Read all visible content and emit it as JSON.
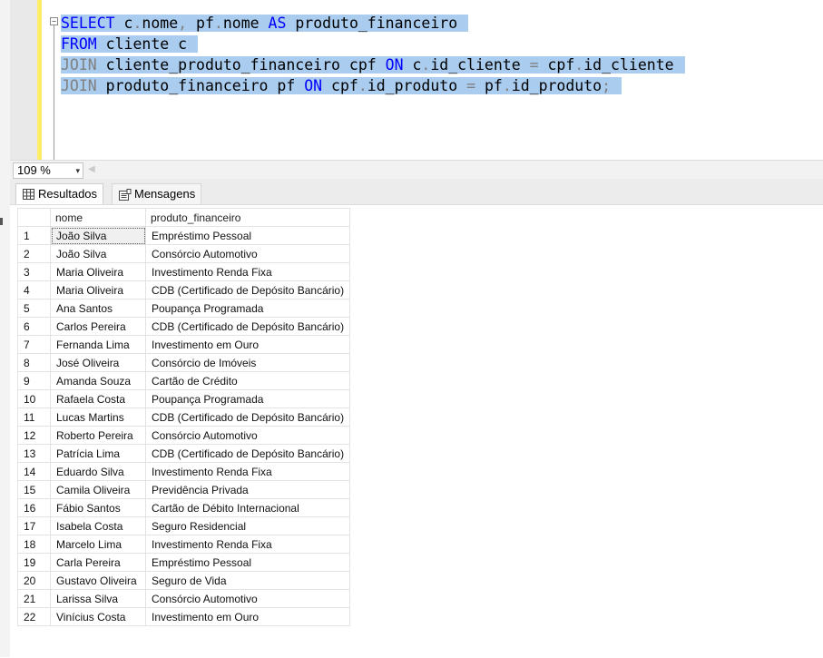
{
  "editor": {
    "lines": [
      [
        {
          "t": "SELECT",
          "c": "kw"
        },
        {
          "t": " c",
          "c": "tx"
        },
        {
          "t": ".",
          "c": "gr"
        },
        {
          "t": "nome",
          "c": "tx"
        },
        {
          "t": ",",
          "c": "gr"
        },
        {
          "t": " pf",
          "c": "tx"
        },
        {
          "t": ".",
          "c": "gr"
        },
        {
          "t": "nome ",
          "c": "tx"
        },
        {
          "t": "AS",
          "c": "kw"
        },
        {
          "t": " produto_financeiro",
          "c": "tx"
        }
      ],
      [
        {
          "t": "FROM",
          "c": "kw"
        },
        {
          "t": " cliente c",
          "c": "tx"
        }
      ],
      [
        {
          "t": "JOIN",
          "c": "gr"
        },
        {
          "t": " cliente_produto_financeiro cpf ",
          "c": "tx"
        },
        {
          "t": "ON",
          "c": "kw"
        },
        {
          "t": " c",
          "c": "tx"
        },
        {
          "t": ".",
          "c": "gr"
        },
        {
          "t": "id_cliente ",
          "c": "tx"
        },
        {
          "t": "=",
          "c": "gr"
        },
        {
          "t": " cpf",
          "c": "tx"
        },
        {
          "t": ".",
          "c": "gr"
        },
        {
          "t": "id_cliente",
          "c": "tx"
        }
      ],
      [
        {
          "t": "JOIN",
          "c": "gr"
        },
        {
          "t": " produto_financeiro pf ",
          "c": "tx"
        },
        {
          "t": "ON",
          "c": "kw"
        },
        {
          "t": " cpf",
          "c": "tx"
        },
        {
          "t": ".",
          "c": "gr"
        },
        {
          "t": "id_produto ",
          "c": "tx"
        },
        {
          "t": "=",
          "c": "gr"
        },
        {
          "t": " pf",
          "c": "tx"
        },
        {
          "t": ".",
          "c": "gr"
        },
        {
          "t": "id_produto",
          "c": "tx"
        },
        {
          "t": ";",
          "c": "gr"
        }
      ]
    ],
    "collapse_glyph": "−"
  },
  "zoom": {
    "value": "109 %",
    "arrow": "▾",
    "scroll_left": "◀"
  },
  "tabs": {
    "results": "Resultados",
    "messages": "Mensagens"
  },
  "results": {
    "columns": [
      "nome",
      "produto_financeiro"
    ],
    "rows": [
      [
        "1",
        "João Silva",
        "Empréstimo Pessoal"
      ],
      [
        "2",
        "João Silva",
        "Consórcio Automotivo"
      ],
      [
        "3",
        "Maria Oliveira",
        "Investimento Renda Fixa"
      ],
      [
        "4",
        "Maria Oliveira",
        "CDB (Certificado de Depósito Bancário)"
      ],
      [
        "5",
        "Ana Santos",
        "Poupança Programada"
      ],
      [
        "6",
        "Carlos Pereira",
        "CDB (Certificado de Depósito Bancário)"
      ],
      [
        "7",
        "Fernanda Lima",
        "Investimento em Ouro"
      ],
      [
        "8",
        "José Oliveira",
        "Consórcio de Imóveis"
      ],
      [
        "9",
        "Amanda Souza",
        "Cartão de Crédito"
      ],
      [
        "10",
        "Rafaela Costa",
        "Poupança Programada"
      ],
      [
        "11",
        "Lucas Martins",
        "CDB (Certificado de Depósito Bancário)"
      ],
      [
        "12",
        "Roberto Pereira",
        "Consórcio Automotivo"
      ],
      [
        "13",
        "Patrícia Lima",
        "CDB (Certificado de Depósito Bancário)"
      ],
      [
        "14",
        "Eduardo Silva",
        "Investimento Renda Fixa"
      ],
      [
        "15",
        "Camila Oliveira",
        "Previdência Privada"
      ],
      [
        "16",
        "Fábio Santos",
        "Cartão de Débito Internacional"
      ],
      [
        "17",
        "Isabela Costa",
        "Seguro Residencial"
      ],
      [
        "18",
        "Marcelo Lima",
        "Investimento Renda Fixa"
      ],
      [
        "19",
        "Carla Pereira",
        "Empréstimo Pessoal"
      ],
      [
        "20",
        "Gustavo Oliveira",
        "Seguro de Vida"
      ],
      [
        "21",
        "Larissa Silva",
        "Consórcio Automotivo"
      ],
      [
        "22",
        "Vinícius Costa",
        "Investimento em Ouro"
      ]
    ]
  },
  "colors": {
    "keyword": "#0000ff",
    "operator": "#808080",
    "selection": "#a9ccef",
    "margin_yellow": "#ffee66"
  }
}
